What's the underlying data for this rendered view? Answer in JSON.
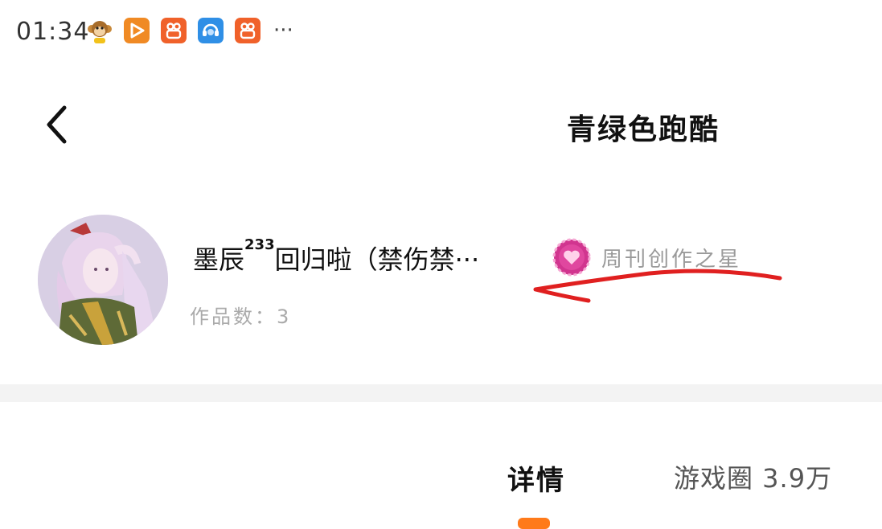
{
  "status_bar": {
    "time": "01:34",
    "app_icons": [
      "monkey-app-icon",
      "video-play-app-icon",
      "kuaishou-app-icon",
      "support-app-icon",
      "kuaishou-app-icon"
    ],
    "more": "···"
  },
  "header": {
    "title": "青绿色跑酷"
  },
  "author": {
    "name_prefix": "墨辰",
    "name_sup": "233",
    "name_suffix": "回归啦（禁伤禁···",
    "badge_label": "周刊创作之星",
    "work_count_label": "作品数：3"
  },
  "tabs": {
    "detail": "详情",
    "circle": "游戏圈 3.9万"
  },
  "colors": {
    "accent": "#ff7a1a",
    "annotation_red": "#e02020",
    "badge_pink": "#d1358f"
  }
}
